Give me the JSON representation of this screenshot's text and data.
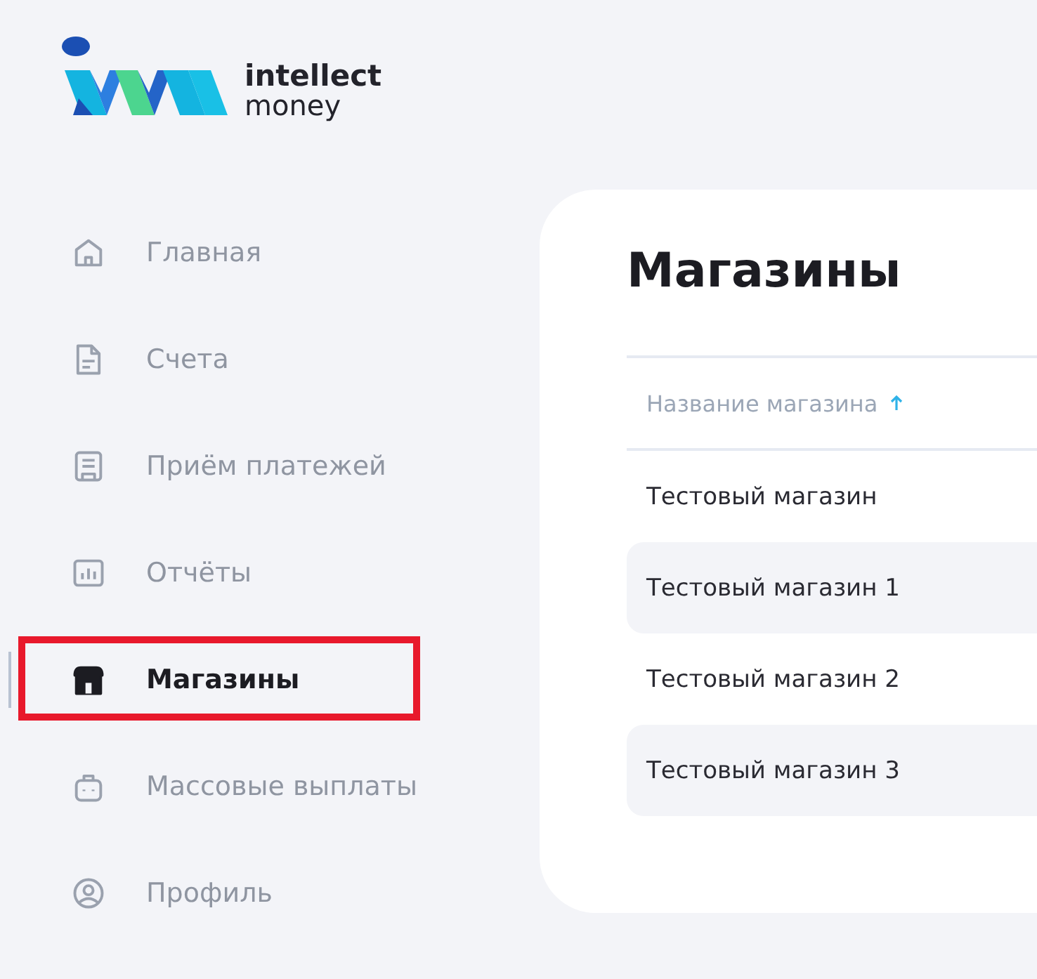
{
  "logo": {
    "line_1": "intellect",
    "line_2": "money"
  },
  "sidebar": {
    "items": [
      {
        "label": "Главная",
        "kind": "home",
        "selected": false
      },
      {
        "label": "Счета",
        "kind": "document",
        "selected": false
      },
      {
        "label": "Приём платежей",
        "kind": "terminal",
        "selected": false
      },
      {
        "label": "Отчёты",
        "kind": "chart",
        "selected": false
      },
      {
        "label": "Магазины",
        "kind": "store",
        "selected": true
      },
      {
        "label": "Массовые выплаты",
        "kind": "bag",
        "selected": false
      },
      {
        "label": "Профиль",
        "kind": "user",
        "selected": false
      }
    ]
  },
  "page": {
    "title": "Магазины"
  },
  "table": {
    "columns": [
      {
        "label": "Название магазина",
        "sorted": true
      }
    ],
    "rows": [
      {
        "cells": [
          "Тестовый магазин"
        ]
      },
      {
        "cells": [
          "Тестовый магазин 1"
        ]
      },
      {
        "cells": [
          "Тестовый магазин 2"
        ]
      },
      {
        "cells": [
          "Тестовый магазин 3"
        ]
      }
    ]
  }
}
